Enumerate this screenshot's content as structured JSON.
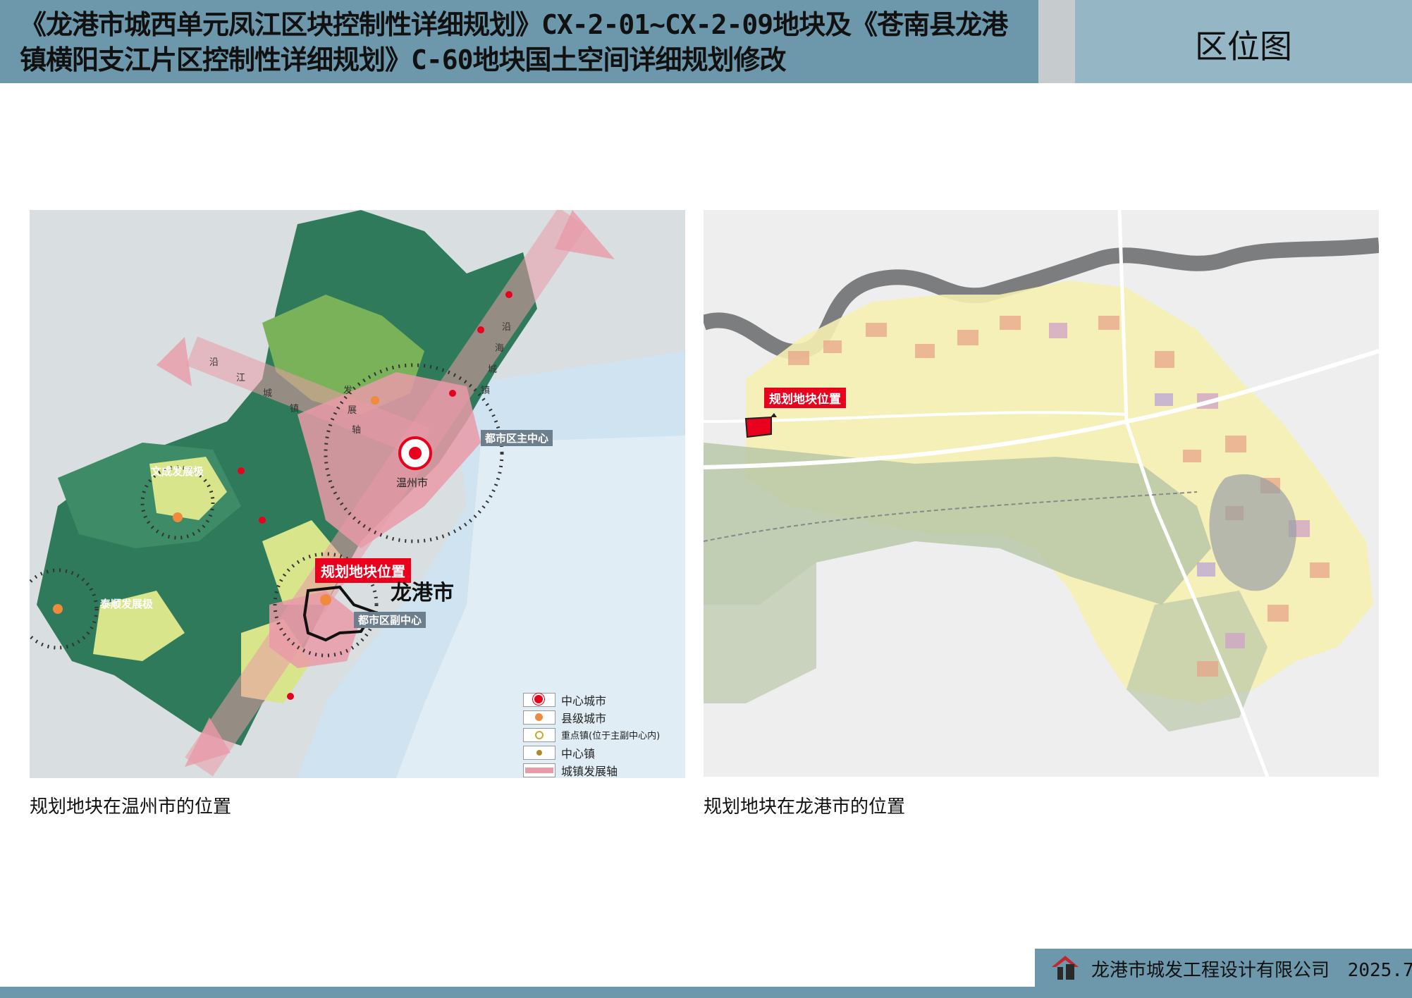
{
  "header": {
    "title": "《龙港市城西单元凤江区块控制性详细规划》CX-2-01~CX-2-09地块及《苍南县龙港镇横阳支江片区控制性详细规划》C-60地块国土空间详细规划修改",
    "section": "区位图"
  },
  "left_map": {
    "caption": "规划地块在温州市的位置",
    "callout": "规划地块位置",
    "city_label": "龙港市",
    "main_center": "都市区主中心",
    "sub_center": "都市区副中心",
    "wenzhou": "温州市",
    "wencheng_axis": "文成发展极",
    "taishun_axis": "泰顺发展极",
    "axis_text_west": [
      "沿",
      "江",
      "城",
      "镇"
    ],
    "axis_text_east": [
      "沿",
      "海",
      "城",
      "镇"
    ],
    "axis_text_center": [
      "发",
      "展",
      "轴"
    ],
    "legend": [
      {
        "label": "中心城市",
        "icon": "central-city-symbol"
      },
      {
        "label": "县级城市",
        "icon": "county-city-dot"
      },
      {
        "label": "重点镇(位于主副中心内)",
        "icon": "key-town-ring"
      },
      {
        "label": "中心镇",
        "icon": "central-town-dot"
      },
      {
        "label": "城镇发展轴",
        "icon": "development-axis-bar"
      }
    ]
  },
  "right_map": {
    "caption": "规划地块在龙港市的位置",
    "callout": "规划地块位置"
  },
  "footer": {
    "company": "龙港市城发工程设计有限公司",
    "date": "2025.7"
  },
  "colors": {
    "header_left": "#6d98ac",
    "header_right": "#95b6c5",
    "callout_red": "#e8001c",
    "forest_green": "#2f7a5a",
    "urban_pink": "#e99aa8"
  }
}
